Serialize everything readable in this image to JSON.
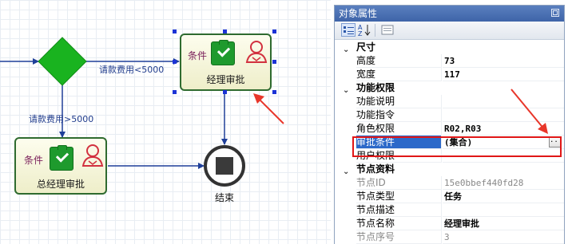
{
  "canvas": {
    "edge_labels": {
      "top": "请款费用<5000",
      "left": "请款费用>5000"
    },
    "tasks": [
      {
        "condition": "条件",
        "name": "经理审批",
        "selected": true
      },
      {
        "condition": "条件",
        "name": "总经理审批",
        "selected": false
      }
    ],
    "end_label": "结束"
  },
  "panel": {
    "title": "对象属性",
    "toolbar": {
      "categorized_icon": "categorized-view-icon",
      "alpha_icon": "alphabetical-sort-icon",
      "pages_icon": "property-pages-icon"
    },
    "groups": [
      {
        "label": "尺寸",
        "rows": [
          {
            "name": "高度",
            "value": "73"
          },
          {
            "name": "宽度",
            "value": "117"
          }
        ]
      },
      {
        "label": "功能权限",
        "rows": [
          {
            "name": "功能说明",
            "value": ""
          },
          {
            "name": "功能指令",
            "value": ""
          },
          {
            "name": "角色权限",
            "value": "R02,R03"
          },
          {
            "name": "审批条件",
            "value": "(集合)",
            "selected": true,
            "button": "..."
          },
          {
            "name": "用户权限",
            "value": ""
          }
        ]
      },
      {
        "label": "节点资料",
        "rows": [
          {
            "name": "节点ID",
            "value": "15e0bbef440fd28",
            "greyed": true
          },
          {
            "name": "节点类型",
            "value": "任务"
          },
          {
            "name": "节点描述",
            "value": ""
          },
          {
            "name": "节点名称",
            "value": "经理审批"
          },
          {
            "name": "节点序号",
            "value": "3",
            "greyed": true
          }
        ]
      }
    ]
  },
  "colors": {
    "task_border": "#2f6b2f",
    "gateway": "#19b31f",
    "highlight_red": "#e01717",
    "selection_blue": "#2c69c9"
  }
}
